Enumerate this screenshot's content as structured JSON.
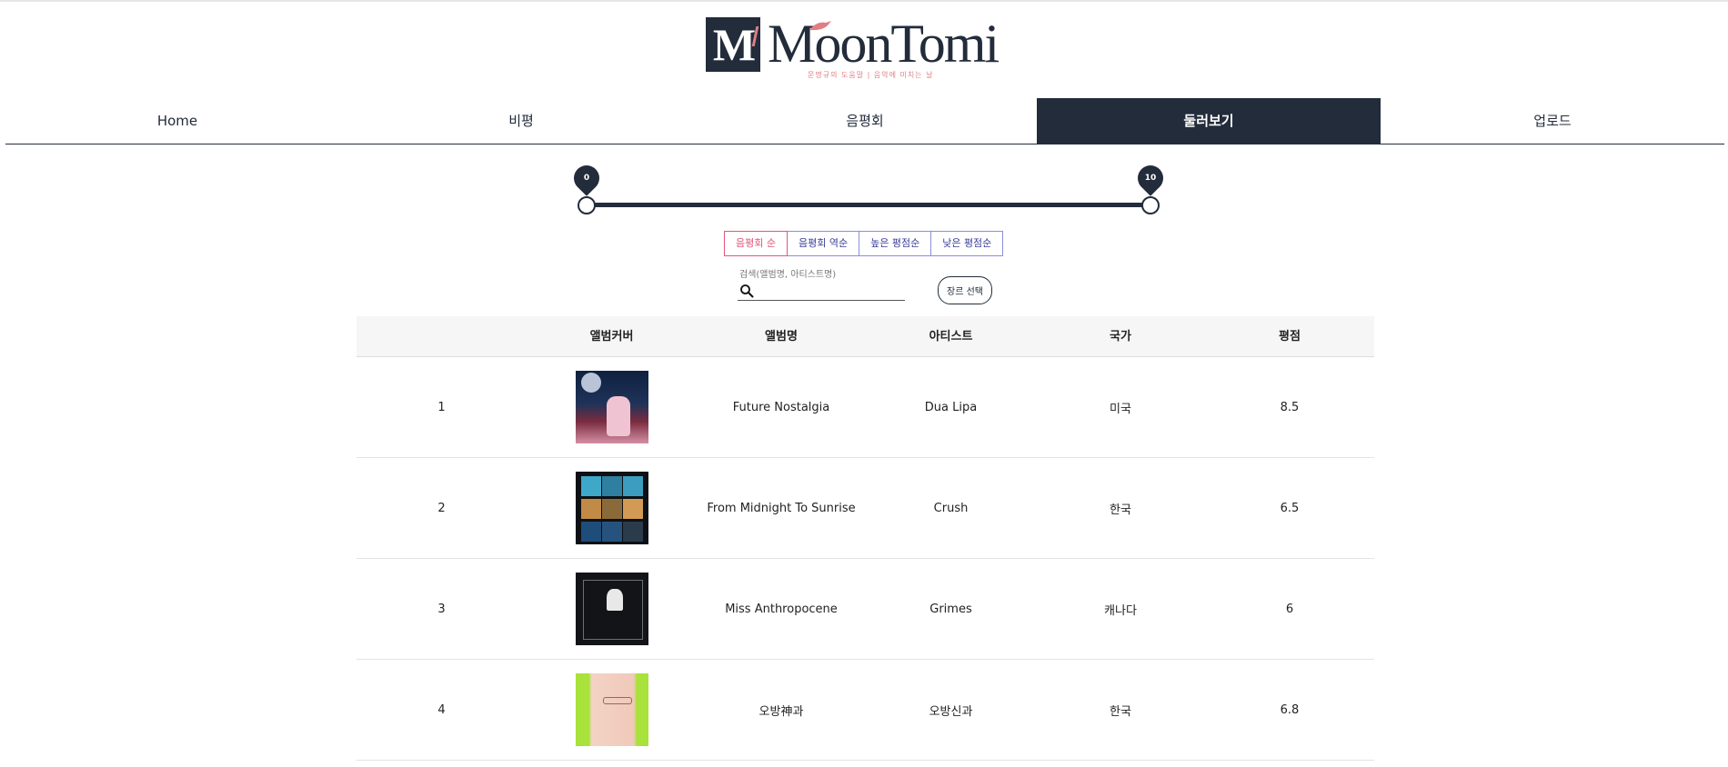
{
  "header": {
    "logo_initial": "M",
    "logo_word": "MoonTomi",
    "tagline": "문명규의 도움말 | 음악에 미치는 날"
  },
  "nav": {
    "items": [
      {
        "label": "Home"
      },
      {
        "label": "비평"
      },
      {
        "label": "음평회"
      },
      {
        "label": "둘러보기",
        "active": true
      },
      {
        "label": "업로드"
      }
    ]
  },
  "range_slider": {
    "min_label": "0",
    "max_label": "10",
    "min_value": 0,
    "max_value": 10
  },
  "sort": {
    "options": [
      {
        "label": "음평회 순",
        "active": true
      },
      {
        "label": "음평회 역순"
      },
      {
        "label": "높은 평점순"
      },
      {
        "label": "낮은 평점순"
      }
    ]
  },
  "search": {
    "label": "검색(앨범명, 아티스트명)",
    "value": "",
    "icon": "search-icon"
  },
  "genre_button": "장르 선택",
  "table": {
    "headers": [
      "",
      "앨범커버",
      "앨범명",
      "아티스트",
      "국가",
      "평점"
    ],
    "rows": [
      {
        "no": "1",
        "album": "Future Nostalgia",
        "artist": "Dua Lipa",
        "country": "미국",
        "rating": "8.5"
      },
      {
        "no": "2",
        "album": "From Midnight To Sunrise",
        "artist": "Crush",
        "country": "한국",
        "rating": "6.5"
      },
      {
        "no": "3",
        "album": "Miss Anthropocene",
        "artist": "Grimes",
        "country": "캐나다",
        "rating": "6"
      },
      {
        "no": "4",
        "album": "오방神과",
        "artist": "오방신과",
        "country": "한국",
        "rating": "6.8"
      }
    ]
  },
  "colors": {
    "primary": "#232c3b",
    "accent_pink": "#e0587a",
    "accent_blue": "#8a8fd8"
  }
}
